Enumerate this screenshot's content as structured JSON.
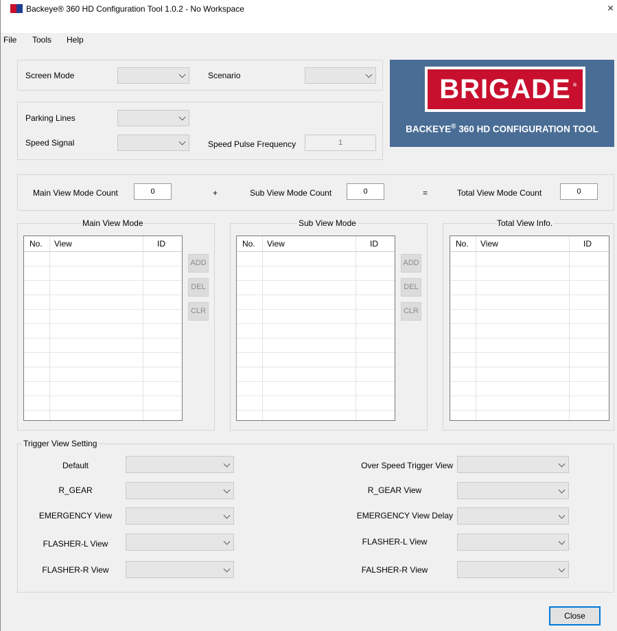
{
  "window": {
    "title": "Backeye® 360 HD Configuration Tool 1.0.2 - No Workspace",
    "close": "×"
  },
  "menu": [
    "File",
    "Tools",
    "Help"
  ],
  "settings": {
    "screen_mode_label": "Screen Mode",
    "scenario_label": "Scenario",
    "parking_lines_label": "Parking Lines",
    "speed_signal_label": "Speed Signal",
    "speed_pulse_label": "Speed Pulse Frequency",
    "speed_pulse_value": "1"
  },
  "logo": {
    "brand": "BRIGADE",
    "reg": "®",
    "subtitle": "BACKEYE",
    "subtitle_mark": "®",
    "subtitle_rest": " 360 HD CONFIGURATION TOOL",
    "bg_color": "#4a6d95",
    "red_color": "#c8102e"
  },
  "counts": {
    "main_label": "Main View Mode Count",
    "main_value": "0",
    "plus": "+",
    "sub_label": "Sub View Mode Count",
    "sub_value": "0",
    "equals": "=",
    "total_label": "Total View Mode Count",
    "total_value": "0"
  },
  "main_view": {
    "title": "Main View Mode",
    "columns": [
      "No.",
      "View",
      "ID"
    ],
    "buttons": [
      "ADD",
      "DEL",
      "CLR"
    ]
  },
  "sub_view": {
    "title": "Sub View Mode",
    "columns": [
      "No.",
      "View",
      "ID"
    ],
    "buttons": [
      "ADD",
      "DEL",
      "CLR"
    ]
  },
  "total_view": {
    "title": "Total View Info.",
    "columns": [
      "No.",
      "View",
      "ID"
    ]
  },
  "trigger": {
    "title": "Trigger View Setting",
    "left": [
      "Default",
      "R_GEAR",
      "EMERGENCY View",
      "FLASHER-L View",
      "FLASHER-R View"
    ],
    "right": [
      "Over Speed Trigger View",
      "R_GEAR View",
      "EMERGENCY View Delay",
      "FLASHER-L View",
      "FALSHER-R View"
    ]
  },
  "footer": {
    "close_label": "Close"
  },
  "icons": [
    "app-icon",
    "close-icon",
    "chevron-down-icon"
  ]
}
